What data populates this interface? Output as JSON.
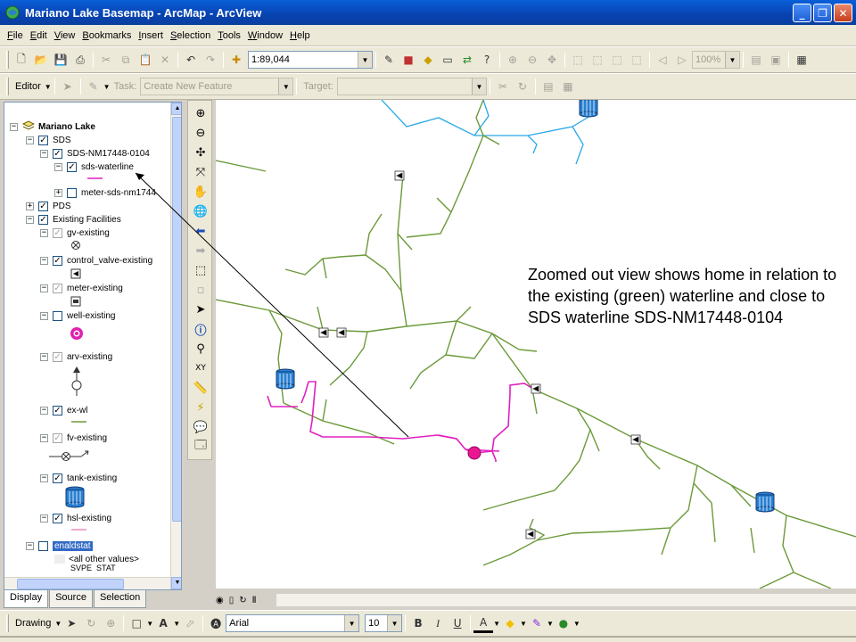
{
  "window": {
    "title": "Mariano Lake Basemap - ArcMap - ArcView",
    "minimize": "_",
    "maximize": "❐",
    "close": "✕"
  },
  "menu": [
    {
      "ul": "F",
      "rest": "ile"
    },
    {
      "ul": "E",
      "rest": "dit"
    },
    {
      "ul": "V",
      "rest": "iew"
    },
    {
      "ul": "B",
      "rest": "ookmarks"
    },
    {
      "ul": "I",
      "rest": "nsert"
    },
    {
      "ul": "S",
      "rest": "election"
    },
    {
      "ul": "T",
      "rest": "ools"
    },
    {
      "ul": "W",
      "rest": "indow"
    },
    {
      "ul": "H",
      "rest": "elp"
    }
  ],
  "standard_toolbar": {
    "scale_value": "1:89,044",
    "zoom_value": "100%"
  },
  "editor_toolbar": {
    "editor_label": "Editor",
    "task_label": "Task:",
    "task_value": "Create New Feature",
    "target_label": "Target:",
    "target_value": ""
  },
  "toc": {
    "root": "Mariano Lake",
    "sds": "SDS",
    "sds_group": "SDS-NM17448-0104",
    "sds_waterline": "sds-waterline",
    "meter_sds": "meter-sds-nm1744",
    "pds": "PDS",
    "existing": "Existing Facilities",
    "gv": "gv-existing",
    "control_valve": "control_valve-existing",
    "meter": "meter-existing",
    "well": "well-existing",
    "arv": "arv-existing",
    "ex_wl": "ex-wl",
    "fv": "fv-existing",
    "tank": "tank-existing",
    "hsl": "hsl-existing",
    "enaldstat": "enaldstat",
    "all_other": "<all other values>",
    "cut_off": "SVPE_STAT"
  },
  "toc_tabs": [
    "Display",
    "Source",
    "Selection"
  ],
  "map": {
    "callout": "Zoomed out view shows home in relation to the existing (green) waterline and close to SDS waterline SDS-NM17448-0104",
    "colors": {
      "existing_waterline": "#6b9a3a",
      "sds_waterline": "#e020c0",
      "blue_line": "#2aa8e8",
      "home_marker": "#e81890"
    }
  },
  "drawing_toolbar": {
    "drawing_label": "Drawing",
    "font_value": "Arial",
    "size_value": "10",
    "bold": "B",
    "italic": "I",
    "underline": "U",
    "font_color_glyph": "A"
  }
}
